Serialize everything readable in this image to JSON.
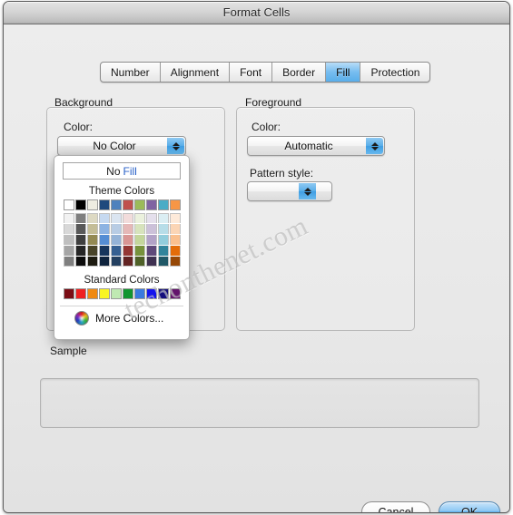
{
  "window": {
    "title": "Format Cells"
  },
  "tabs": [
    {
      "label": "Number",
      "selected": false
    },
    {
      "label": "Alignment",
      "selected": false
    },
    {
      "label": "Font",
      "selected": false
    },
    {
      "label": "Border",
      "selected": false
    },
    {
      "label": "Fill",
      "selected": true
    },
    {
      "label": "Protection",
      "selected": false
    }
  ],
  "background": {
    "group_label": "Background",
    "color_label": "Color:",
    "color_value": "No Color"
  },
  "foreground": {
    "group_label": "Foreground",
    "color_label": "Color:",
    "color_value": "Automatic",
    "pattern_label": "Pattern style:",
    "pattern_value": ""
  },
  "sample": {
    "label": "Sample",
    "value": ""
  },
  "buttons": {
    "cancel": "Cancel",
    "ok": "OK"
  },
  "watermark": {
    "text": "techonthenet.com"
  },
  "color_menu": {
    "no_fill_prefix": "No ",
    "no_fill_highlight": "Fill",
    "theme_heading": "Theme Colors",
    "standard_heading": "Standard Colors",
    "more_colors_label": "More Colors...",
    "more_colors_icon": "color-wheel-icon",
    "theme_colors": [
      {
        "name": "Background 1",
        "base": "#ffffff",
        "tints": [
          "#f2f2f2",
          "#d8d8d8",
          "#bfbfbf",
          "#a5a5a5",
          "#7f7f7f"
        ]
      },
      {
        "name": "Text 1",
        "base": "#000000",
        "tints": [
          "#7f7f7f",
          "#595959",
          "#3f3f3f",
          "#262626",
          "#0c0c0c"
        ]
      },
      {
        "name": "Background 2",
        "base": "#eeece1",
        "tints": [
          "#ddd9c3",
          "#c4bd97",
          "#938953",
          "#494429",
          "#1d1b10"
        ]
      },
      {
        "name": "Text 2",
        "base": "#1f497d",
        "tints": [
          "#c6d9f0",
          "#8db3e2",
          "#548dd4",
          "#17365d",
          "#0f243e"
        ]
      },
      {
        "name": "Accent 1",
        "base": "#4f81bd",
        "tints": [
          "#dbe5f1",
          "#b8cce4",
          "#95b3d7",
          "#366092",
          "#244061"
        ]
      },
      {
        "name": "Accent 2",
        "base": "#c0504d",
        "tints": [
          "#f2dcdb",
          "#e5b8b7",
          "#d99694",
          "#953734",
          "#632423"
        ]
      },
      {
        "name": "Accent 3",
        "base": "#9bbb59",
        "tints": [
          "#ebf1dd",
          "#d7e3bc",
          "#c3d69b",
          "#76923c",
          "#4f6128"
        ]
      },
      {
        "name": "Accent 4",
        "base": "#8064a2",
        "tints": [
          "#e5e0ec",
          "#ccc1d9",
          "#b2a2c7",
          "#5f497a",
          "#3f3151"
        ]
      },
      {
        "name": "Accent 5",
        "base": "#4bacc6",
        "tints": [
          "#dbeef3",
          "#b7dde8",
          "#92cddc",
          "#31849b",
          "#205867"
        ]
      },
      {
        "name": "Accent 6",
        "base": "#f79646",
        "tints": [
          "#fdeada",
          "#fbd5b5",
          "#fac08f",
          "#e36c09",
          "#974806"
        ]
      }
    ],
    "standard_colors": [
      {
        "name": "Dark Red",
        "hex": "#7b0d15"
      },
      {
        "name": "Red",
        "hex": "#ef2020"
      },
      {
        "name": "Orange",
        "hex": "#f08a12"
      },
      {
        "name": "Yellow",
        "hex": "#f9f521"
      },
      {
        "name": "Light Green",
        "hex": "#bfe9b2"
      },
      {
        "name": "Green",
        "hex": "#11952f"
      },
      {
        "name": "Light Blue",
        "hex": "#3a7ade"
      },
      {
        "name": "Blue",
        "hex": "#1414ed"
      },
      {
        "name": "Dark Blue",
        "hex": "#130e7c"
      },
      {
        "name": "Purple",
        "hex": "#63146b"
      }
    ]
  }
}
